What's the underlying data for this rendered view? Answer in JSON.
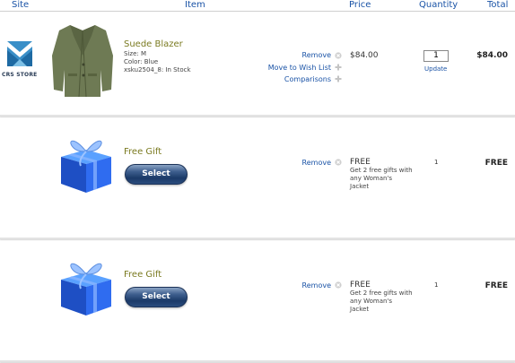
{
  "header": {
    "site": "Site",
    "item": "Item",
    "price": "Price",
    "quantity": "Quantity",
    "total": "Total"
  },
  "store": {
    "label": "CRS STORE"
  },
  "rows": [
    {
      "name": "Suede Blazer",
      "size": "Size: M",
      "color": "Color: Blue",
      "sku": "xsku2504_8: In Stock",
      "links": {
        "remove": "Remove",
        "wishlist": "Move to Wish List",
        "compare": "Comparisons"
      },
      "price": "$84.00",
      "quantity": "1",
      "update": "Update",
      "total": "$84.00"
    },
    {
      "name": "Free Gift",
      "button": "Select",
      "remove": "Remove",
      "price": "FREE",
      "desc": "Get 2 free gifts with any Woman's Jacket",
      "quantity": "1",
      "total": "FREE"
    },
    {
      "name": "Free Gift",
      "button": "Select",
      "remove": "Remove",
      "price": "FREE",
      "desc": "Get 2 free gifts with any Woman's Jacket",
      "quantity": "1",
      "total": "FREE"
    }
  ],
  "icons": {
    "remove": "remove-x-icon",
    "add": "plus-icon",
    "store": "crs-store-logo",
    "product": "jacket-image",
    "gift": "gift-box-image"
  }
}
